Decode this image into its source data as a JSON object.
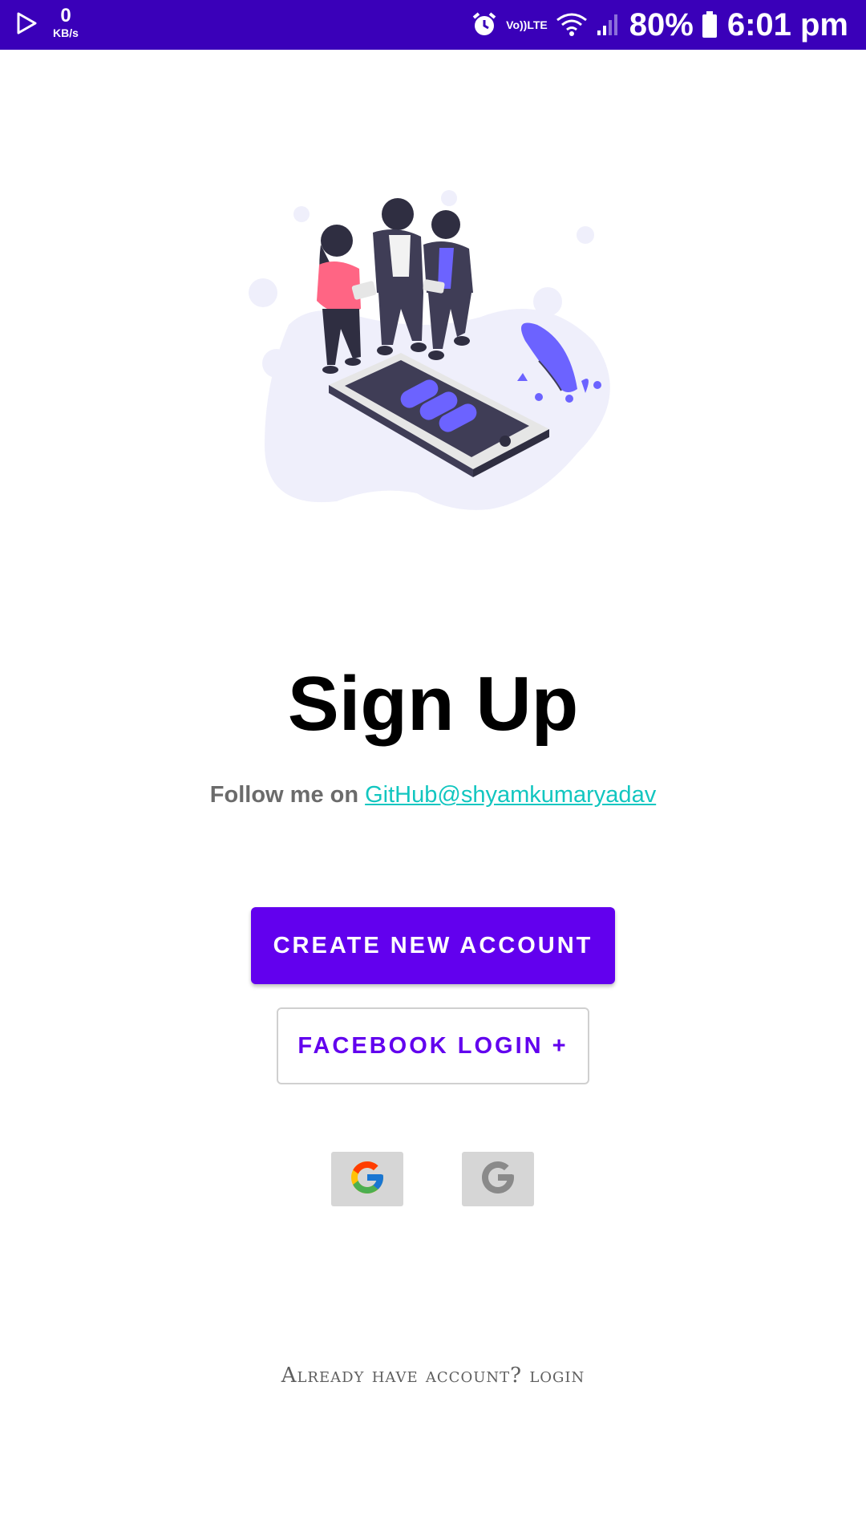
{
  "status_bar": {
    "net_speed_value": "0",
    "net_speed_unit": "KB/s",
    "volte_top": "Vo))",
    "volte_bottom": "LTE",
    "battery_percent": "80%",
    "time": "6:01 pm",
    "background_color": "#3a00b9"
  },
  "illustration": {
    "icon": "people-with-phone-illustration"
  },
  "main": {
    "title": "Sign Up",
    "follow_prefix": "Follow me on ",
    "github_link": "GitHub@shyamkumaryadav",
    "create_account_label": "CREATE NEW ACCOUNT",
    "facebook_login_label": "FACEBOOK LOGIN +",
    "google_buttons": [
      {
        "icon": "google-color-icon"
      },
      {
        "icon": "google-gray-icon"
      }
    ],
    "login_link": "Already have account? login"
  },
  "colors": {
    "accent": "#6200ee",
    "link": "#12c6c0"
  }
}
